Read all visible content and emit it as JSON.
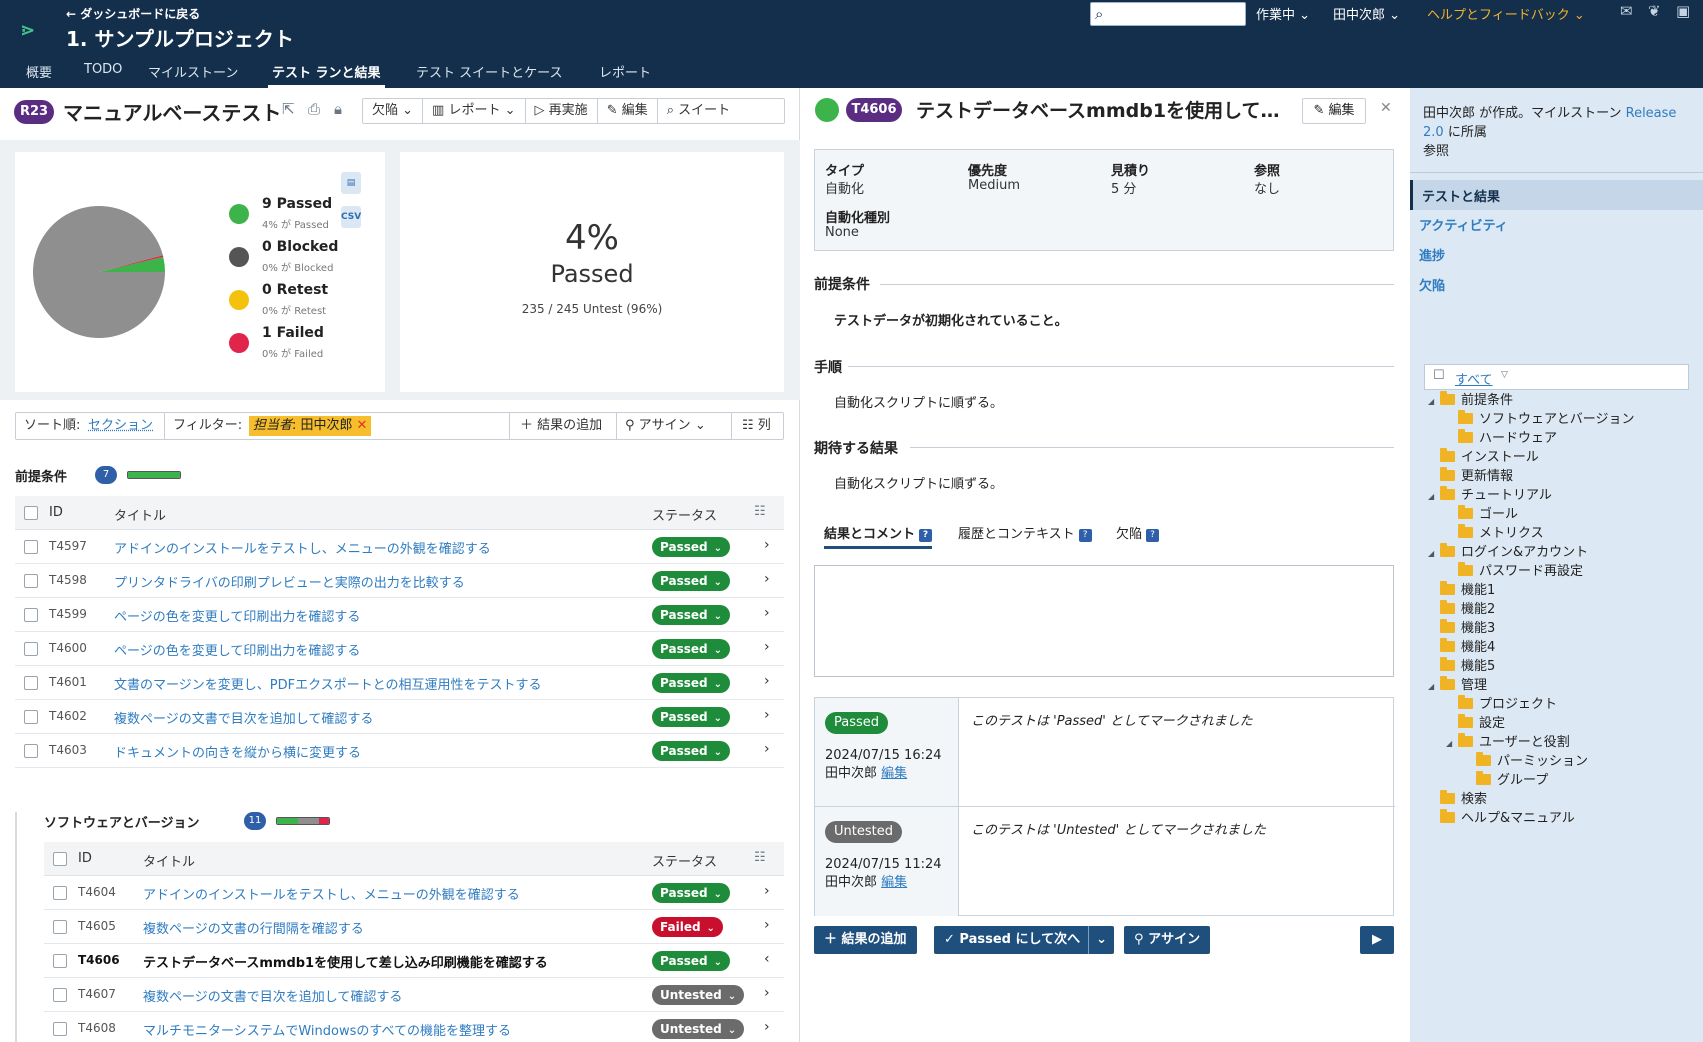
{
  "header": {
    "back_link": "← ダッシュボードに戻る",
    "project_title": "1. サンプルプロジェクト",
    "nav_tabs": [
      "概要",
      "TODO",
      "マイルストーン",
      "テスト ランと結果",
      "テスト スイートとケース",
      "レポート"
    ],
    "active_tab_index": 3,
    "search_placeholder": "",
    "status_menu": "作業中",
    "user_menu": "田中次郎",
    "help_menu": "ヘルプとフィードバック",
    "icons": [
      "mail-icon",
      "twitter-icon",
      "feed-icon"
    ]
  },
  "run": {
    "badge": "R23",
    "title": "マニュアルベーステスト",
    "toolbar": [
      "欠陥",
      "レポート",
      "再実施",
      "編集",
      "スイート"
    ]
  },
  "chart_data": {
    "type": "pie",
    "legend": [
      {
        "label": "9 Passed",
        "sub": "4% が Passed",
        "color": "#3cb44b",
        "value": 9
      },
      {
        "label": "0 Blocked",
        "sub": "0% が Blocked",
        "color": "#555555",
        "value": 0
      },
      {
        "label": "0 Retest",
        "sub": "0% が Retest",
        "color": "#f4c20d",
        "value": 0
      },
      {
        "label": "1 Failed",
        "sub": "0% が Failed",
        "color": "#e0244a",
        "value": 1
      },
      {
        "label": "Untested",
        "color": "#8f8f8f",
        "value": 235
      }
    ],
    "summary_percent": "4%",
    "summary_status": "Passed",
    "summary_untested": "235 / 245 Untest (96%)"
  },
  "filterbar": {
    "sort_label": "ソート順:",
    "sort_value": "セクション",
    "filter_label": "フィルター:",
    "chip_key": "担当者",
    "chip_value": ": 田中次郎",
    "add_result": "結果の追加",
    "assign": "アサイン",
    "columns": "列"
  },
  "table_headers": {
    "id": "ID",
    "title": "タイトル",
    "status": "ステータス"
  },
  "sections": [
    {
      "title": "前提条件",
      "count": "7",
      "rows": [
        {
          "id": "T4597",
          "title": "アドインのインストールをテストし、メニューの外観を確認する",
          "status": "Passed"
        },
        {
          "id": "T4598",
          "title": "プリンタドライバの印刷プレビューと実際の出力を比較する",
          "status": "Passed"
        },
        {
          "id": "T4599",
          "title": "ページの色を変更して印刷出力を確認する",
          "status": "Passed"
        },
        {
          "id": "T4600",
          "title": "ページの色を変更して印刷出力を確認する",
          "status": "Passed"
        },
        {
          "id": "T4601",
          "title": "文書のマージンを変更し、PDFエクスポートとの相互運用性をテストする",
          "status": "Passed"
        },
        {
          "id": "T4602",
          "title": "複数ページの文書で目次を追加して確認する",
          "status": "Passed"
        },
        {
          "id": "T4603",
          "title": "ドキュメントの向きを縦から横に変更する",
          "status": "Passed"
        }
      ]
    },
    {
      "title": "ソフトウェアとバージョン",
      "count": "11",
      "rows": [
        {
          "id": "T4604",
          "title": "アドインのインストールをテストし、メニューの外観を確認する",
          "status": "Passed"
        },
        {
          "id": "T4605",
          "title": "複数ページの文書の行間隔を確認する",
          "status": "Failed"
        },
        {
          "id": "T4606",
          "title": "テストデータベースmmdb1を使用して差し込み印刷機能を確認する",
          "status": "Passed",
          "selected": true
        },
        {
          "id": "T4607",
          "title": "複数ページの文書で目次を追加して確認する",
          "status": "Untested"
        },
        {
          "id": "T4608",
          "title": "マルチモニターシステムでWindowsのすべての機能を整理する",
          "status": "Untested"
        }
      ]
    }
  ],
  "status_colors": {
    "Passed": "#1e8c3a",
    "Failed": "#c8102e",
    "Untested": "#6b6b6b"
  },
  "detail": {
    "badge": "T4606",
    "title": "テストデータベースmmdb1を使用して差し込み印刷機能を確認する",
    "edit": "編集",
    "info": [
      {
        "label": "タイプ",
        "value": "自動化"
      },
      {
        "label": "優先度",
        "value": "Medium"
      },
      {
        "label": "見積り",
        "value": "5 分"
      },
      {
        "label": "参照",
        "value": "なし"
      },
      {
        "label": "自動化種別",
        "value": "None"
      }
    ],
    "precond_head": "前提条件",
    "precond_text": "テストデータが初期化されていること。",
    "steps_head": "手順",
    "steps_text": "自動化スクリプトに順ずる。",
    "expected_head": "期待する結果",
    "expected_text": "自動化スクリプトに順ずる。",
    "tabs": [
      "結果とコメント",
      "履歴とコンテキスト",
      "欠陥"
    ],
    "history": [
      {
        "status": "Passed",
        "color": "#1e8c3a",
        "date": "2024/07/15 16:24 田中次郎",
        "edit": "編集",
        "msg": "このテストは 'Passed' としてマークされました"
      },
      {
        "status": "Untested",
        "color": "#6b6b6b",
        "date": "2024/07/15 11:24 田中次郎",
        "edit": "編集",
        "msg": "このテストは 'Untested' としてマークされました"
      }
    ],
    "actions": {
      "add_result": "結果の追加",
      "pass_next": "Passed にして次へ",
      "assign": "アサイン"
    }
  },
  "sidebar": {
    "created_by": "田中次郎 が作成。マイルストーン",
    "milestone": "Release 2.0",
    "belongs": "に所属",
    "ref": "参照",
    "nav": [
      "テストと結果",
      "アクティビティ",
      "進捗",
      "欠陥"
    ],
    "tree_filter": "すべて",
    "tree": [
      {
        "label": "前提条件",
        "level": 0,
        "toggle": true
      },
      {
        "label": "ソフトウェアとバージョン",
        "level": 1
      },
      {
        "label": "ハードウェア",
        "level": 1
      },
      {
        "label": "インストール",
        "level": 0
      },
      {
        "label": "更新情報",
        "level": 0
      },
      {
        "label": "チュートリアル",
        "level": 0,
        "toggle": true
      },
      {
        "label": "ゴール",
        "level": 1
      },
      {
        "label": "メトリクス",
        "level": 1
      },
      {
        "label": "ログイン&アカウント",
        "level": 0,
        "toggle": true
      },
      {
        "label": "パスワード再設定",
        "level": 1
      },
      {
        "label": "機能1",
        "level": 0
      },
      {
        "label": "機能2",
        "level": 0
      },
      {
        "label": "機能3",
        "level": 0
      },
      {
        "label": "機能4",
        "level": 0
      },
      {
        "label": "機能5",
        "level": 0
      },
      {
        "label": "管理",
        "level": 0,
        "toggle": true
      },
      {
        "label": "プロジェクト",
        "level": 1
      },
      {
        "label": "設定",
        "level": 1
      },
      {
        "label": "ユーザーと役割",
        "level": 1,
        "toggle": true
      },
      {
        "label": "パーミッション",
        "level": 2
      },
      {
        "label": "グループ",
        "level": 2
      },
      {
        "label": "検索",
        "level": 0
      },
      {
        "label": "ヘルプ&マニュアル",
        "level": 0
      }
    ]
  }
}
